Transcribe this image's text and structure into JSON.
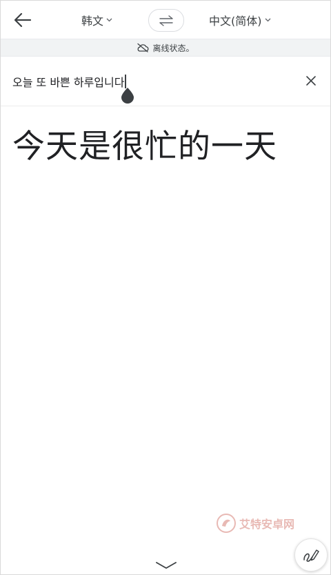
{
  "header": {
    "source_language": "韩文",
    "target_language": "中文(简体)"
  },
  "status": {
    "text": "离线状态。"
  },
  "input": {
    "text": "오늘 또 바쁜 하루입니다"
  },
  "output": {
    "translation": "今天是很忙的一天"
  },
  "watermark": {
    "text": "艾特安卓网"
  },
  "colors": {
    "icon": "#3c4043",
    "status_bg": "#f1f3f4",
    "watermark": "#c0392b"
  }
}
